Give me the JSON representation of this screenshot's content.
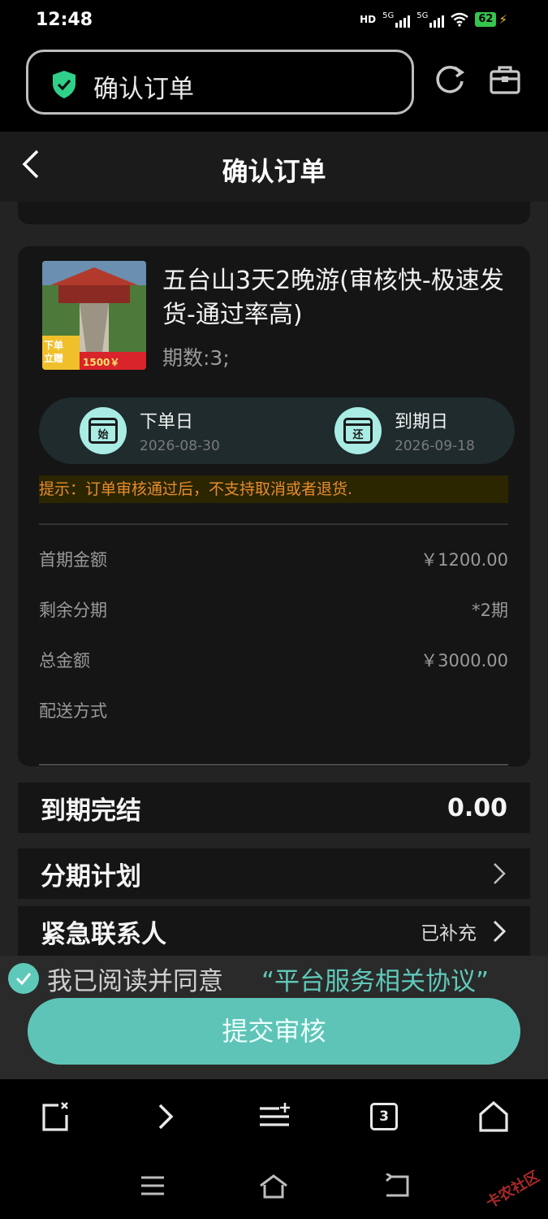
{
  "status_bar": {
    "time": "12:48",
    "network_labels": [
      "HD",
      "5G",
      "5G"
    ],
    "battery": "62"
  },
  "browser": {
    "tab_title": "确认订单"
  },
  "header": {
    "title": "确认订单"
  },
  "product": {
    "name": "五台山3天2晚游(审核快-极速发货-通过率高)",
    "period": "期数:3;",
    "image_badge": "下单立赠",
    "image_price": "1500￥"
  },
  "dates": {
    "order": {
      "label": "下单日",
      "value": "2026-08-30",
      "icon_char": "始"
    },
    "due": {
      "label": "到期日",
      "value": "2026-09-18",
      "icon_char": "还"
    }
  },
  "tip": "提示：订单审核通过后，不支持取消或者退货.",
  "details": [
    {
      "label": "首期金额",
      "value": "￥1200.00"
    },
    {
      "label": "剩余分期",
      "value": "*2期"
    },
    {
      "label": "总金额",
      "value": "￥3000.00"
    },
    {
      "label": "配送方式",
      "value": ""
    }
  ],
  "summary": {
    "label": "到期完结",
    "value": "0.00"
  },
  "plan": {
    "label": "分期计划"
  },
  "contact": {
    "label": "紧急联系人",
    "status": "已补充"
  },
  "agreement": {
    "prefix": "我已阅读并同意",
    "link": "“平台服务相关协议”"
  },
  "submit_label": "提交审核",
  "browser_nav": {
    "tab_count": "3"
  },
  "watermark": "卡农社区",
  "colors": {
    "accent": "#5ec4b7",
    "tip": "#e88b2f",
    "background": "#232323",
    "card": "#151515"
  }
}
